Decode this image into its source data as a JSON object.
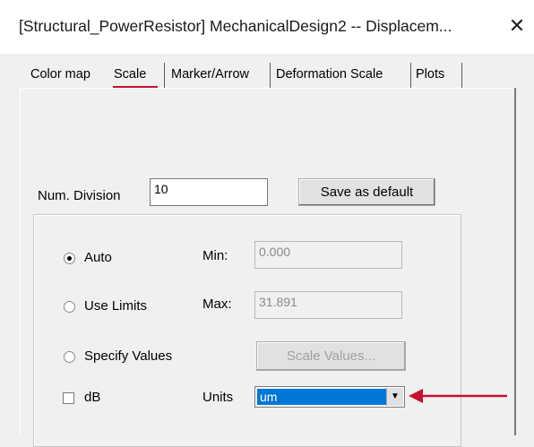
{
  "window": {
    "title": "[Structural_PowerResistor] MechanicalDesign2 -- Displacem...",
    "close_glyph": "✕"
  },
  "tabs": [
    {
      "label": "Color map"
    },
    {
      "label": "Scale"
    },
    {
      "label": "Marker/Arrow"
    },
    {
      "label": "Deformation Scale"
    },
    {
      "label": "Plots"
    }
  ],
  "active_tab": "Scale",
  "colors": {
    "accent_underline": "#c8102e",
    "selection": "#0078d7",
    "annotation_arrow": "#c8102e"
  },
  "scale": {
    "num_division_label": "Num. Division",
    "num_division_value": "10",
    "save_default_label": "Save as default",
    "auto_label": "Auto",
    "use_limits_label": "Use Limits",
    "specify_values_label": "Specify Values",
    "min_label": "Min:",
    "min_value": "0.000",
    "max_label": "Max:",
    "max_value": "31.891",
    "scale_values_label": "Scale Values...",
    "db_label": "dB",
    "units_label": "Units",
    "units_value": "um",
    "selected_mode": "Auto",
    "db_checked": false
  }
}
